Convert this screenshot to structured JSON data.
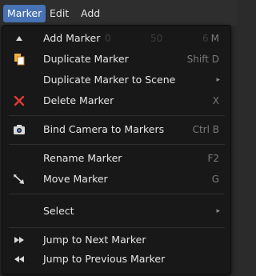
{
  "menubar": {
    "items": [
      {
        "label": "Marker",
        "active": true
      },
      {
        "label": "Edit",
        "active": false
      },
      {
        "label": "Add",
        "active": false
      }
    ]
  },
  "background_ruler": {
    "ticks": [
      "0",
      "50",
      "6"
    ]
  },
  "menu": {
    "items": [
      {
        "label": "Add Marker",
        "shortcut": "M",
        "icon": "triangle-up-icon"
      },
      {
        "label": "Duplicate Marker",
        "shortcut": "Shift D",
        "icon": "duplicate-icon"
      },
      {
        "label": "Duplicate Marker to Scene",
        "shortcut": "",
        "icon": "",
        "submenu_arrow": "▸"
      },
      {
        "label": "Delete Marker",
        "shortcut": "X",
        "icon": "delete-x-icon"
      },
      {
        "label": "Bind Camera to Markers",
        "shortcut": "Ctrl B",
        "icon": "camera-icon"
      },
      {
        "label": "Rename Marker",
        "shortcut": "F2",
        "icon": ""
      },
      {
        "label": "Move Marker",
        "shortcut": "G",
        "icon": "move-arrow-icon"
      },
      {
        "label": "Select",
        "shortcut": "",
        "icon": "",
        "submenu_arrow": "▸"
      },
      {
        "label": "Jump to Next Marker",
        "shortcut": "",
        "icon": "jump-next-icon"
      },
      {
        "label": "Jump to Previous Marker",
        "shortcut": "",
        "icon": "jump-previous-icon"
      }
    ]
  },
  "colors": {
    "accent": "#4772b3",
    "panel_bg": "#181818",
    "text": "#e6e6e6",
    "shortcut_text": "#7a7a7a",
    "delete_red": "#e03a3a",
    "duplicate_orange": "#e8a13a"
  }
}
